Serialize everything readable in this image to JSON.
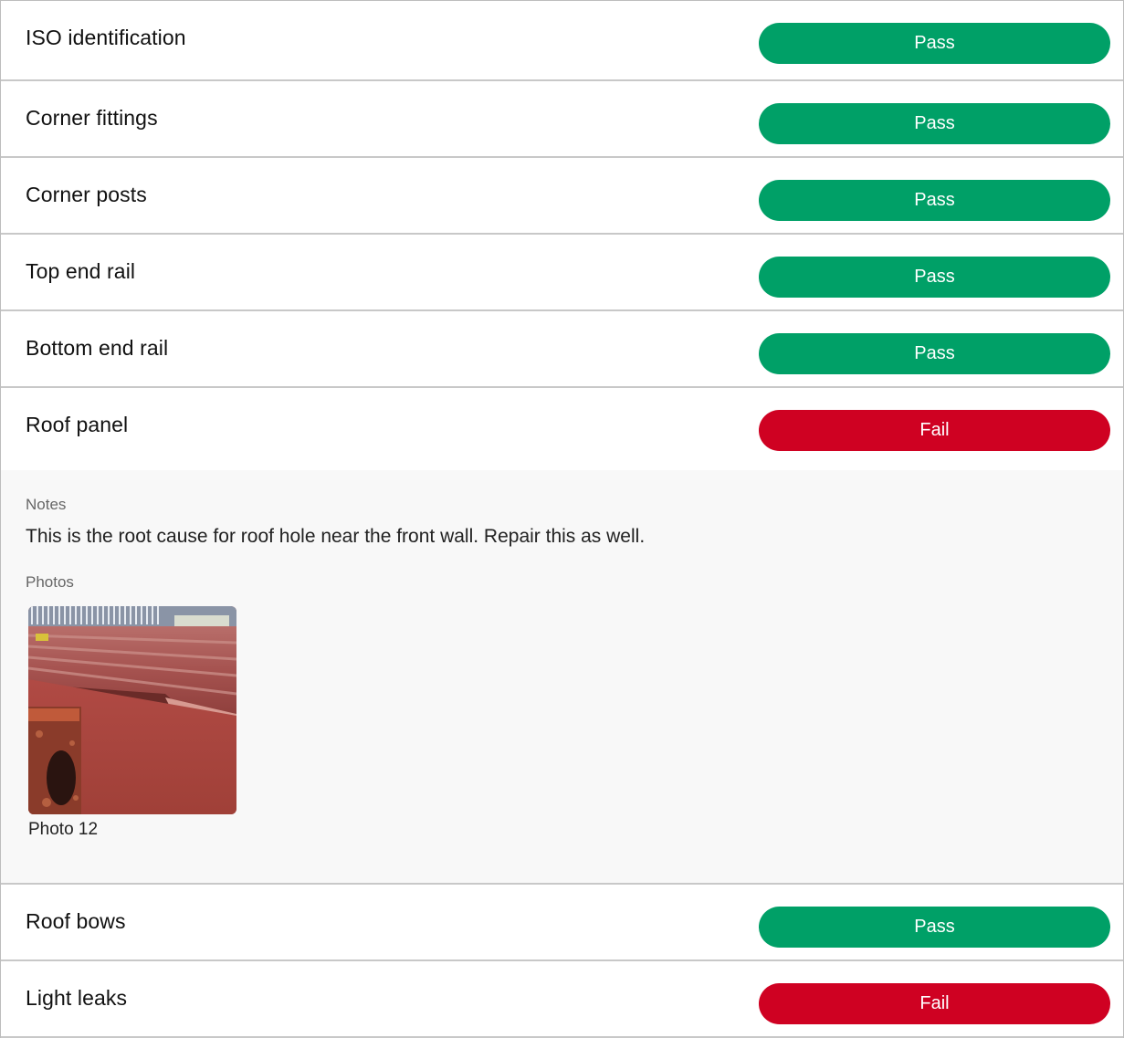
{
  "items": [
    {
      "label": "ISO identification",
      "status": "Pass"
    },
    {
      "label": "Corner fittings",
      "status": "Pass"
    },
    {
      "label": "Corner posts",
      "status": "Pass"
    },
    {
      "label": "Top end rail",
      "status": "Pass"
    },
    {
      "label": "Bottom end rail",
      "status": "Pass"
    },
    {
      "label": "Roof panel",
      "status": "Fail"
    },
    {
      "label": "Roof bows",
      "status": "Pass"
    },
    {
      "label": "Light leaks",
      "status": "Fail"
    }
  ],
  "detail": {
    "notes_label": "Notes",
    "notes_text": "This is the root cause for roof hole near the front wall. Repair this as well.",
    "photos_label": "Photos",
    "photo_caption": "Photo 12"
  },
  "colors": {
    "pass": "#00a067",
    "fail": "#cf0122",
    "detail_bg": "#f8f8f8"
  }
}
